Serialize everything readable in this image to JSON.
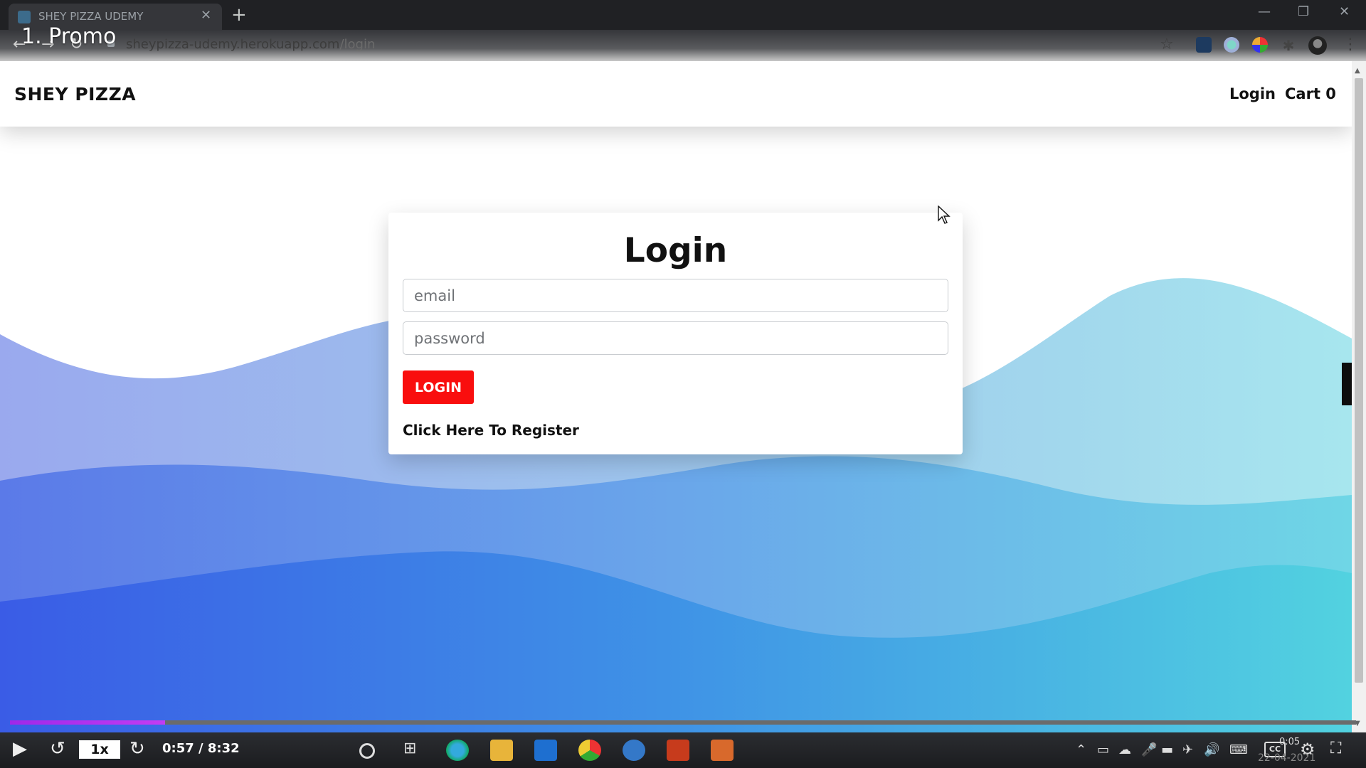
{
  "browser": {
    "tab_title": "SHEY PIZZA UDEMY",
    "tab_close": "✕",
    "new_tab": "+",
    "url_domain": "sheypizza-udemy.herokuapp.com",
    "url_path": "/login",
    "minimize": "—",
    "restore": "❐",
    "close": "✕"
  },
  "overlay": {
    "lecture_title": "1. Promo"
  },
  "navbar": {
    "brand": "SHEY PIZZA",
    "login": "Login",
    "cart": "Cart 0"
  },
  "login_form": {
    "title": "Login",
    "email_placeholder": "email",
    "password_placeholder": "password",
    "submit_label": "LOGIN",
    "register_link": "Click Here To Register"
  },
  "player": {
    "speed": "1x",
    "time": "0:57 / 8:32",
    "progress_fraction": 0.115
  },
  "taskbar": {
    "clock_time": "0:05",
    "clock_date": "22-04-2021"
  },
  "colors": {
    "login_button": "#f90e0e",
    "progress": "#a028e8",
    "wave_left": "#4a69e8",
    "wave_right": "#5ad6e3"
  }
}
